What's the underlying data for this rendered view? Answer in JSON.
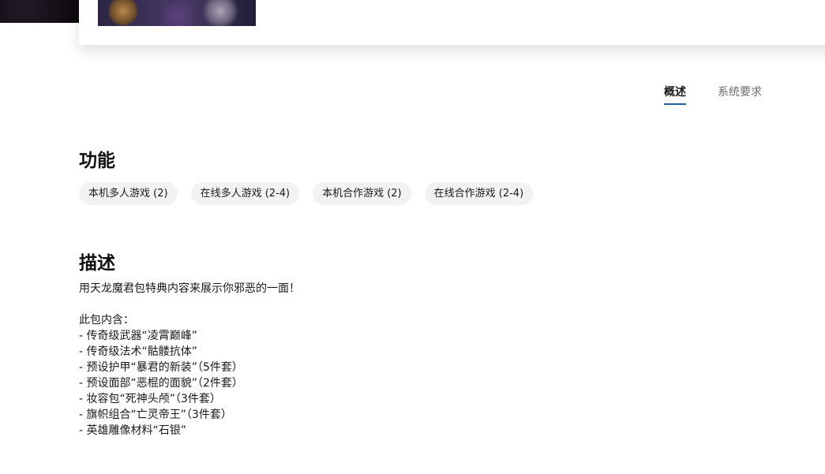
{
  "tabs": [
    {
      "label": "概述",
      "active": true
    },
    {
      "label": "系统要求",
      "active": false
    }
  ],
  "features": {
    "title": "功能",
    "chips": [
      "本机多人游戏 (2)",
      "在线多人游戏 (2-4)",
      "本机合作游戏 (2)",
      "在线合作游戏 (2-4)"
    ]
  },
  "description": {
    "title": "描述",
    "intro": "用天龙魔君包特典内容来展示你邪恶的一面！",
    "contents_heading": "此包内含：",
    "items": [
      "- 传奇级武器“凌霄巅峰”",
      "- 传奇级法术“骷髅抗体”",
      "- 预设护甲“暴君的新装”（5件套）",
      "- 预设面部“恶棍的面貌”（2件套）",
      "- 妆容包“死神头颅”（3件套）",
      "- 旗帜组合“亡灵帝王”（3件套）",
      "- 英雄雕像材料“石银”"
    ]
  },
  "colors": {
    "tab_underline": "#1f5e9e",
    "chip_bg": "#f2f2f2"
  }
}
